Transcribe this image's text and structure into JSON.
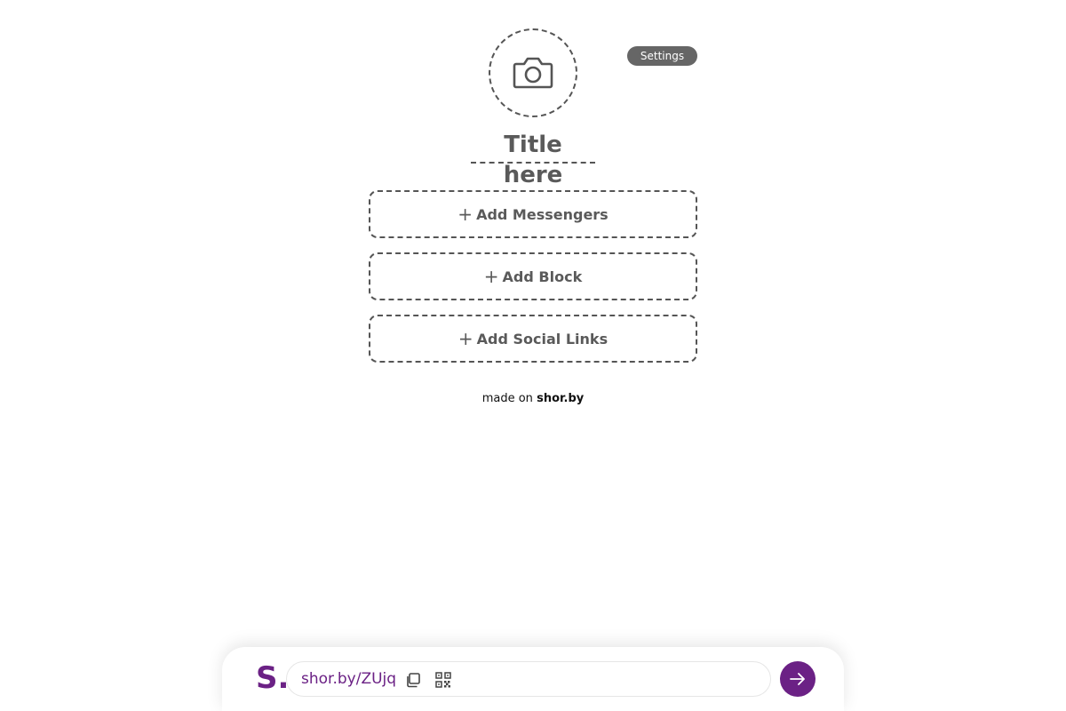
{
  "header": {
    "avatar_icon": "camera-icon",
    "settings_label": "Settings"
  },
  "title": "Title here",
  "blocks": [
    {
      "label": "Add Messengers",
      "icon": "plus-icon"
    },
    {
      "label": "Add Block",
      "icon": "plus-icon"
    },
    {
      "label": "Add Social Links",
      "icon": "plus-icon"
    }
  ],
  "credit": {
    "prefix": "made on",
    "brand": "shor.by"
  },
  "footer": {
    "logo": "S.",
    "short_url": "shor.by/ZUjq",
    "copy_icon": "copy-icon",
    "qr_icon": "qr-code-icon",
    "go_icon": "arrow-right-icon"
  },
  "colors": {
    "accent": "#6b2185",
    "settings_bg": "#666666",
    "dashed_border": "#555555"
  }
}
